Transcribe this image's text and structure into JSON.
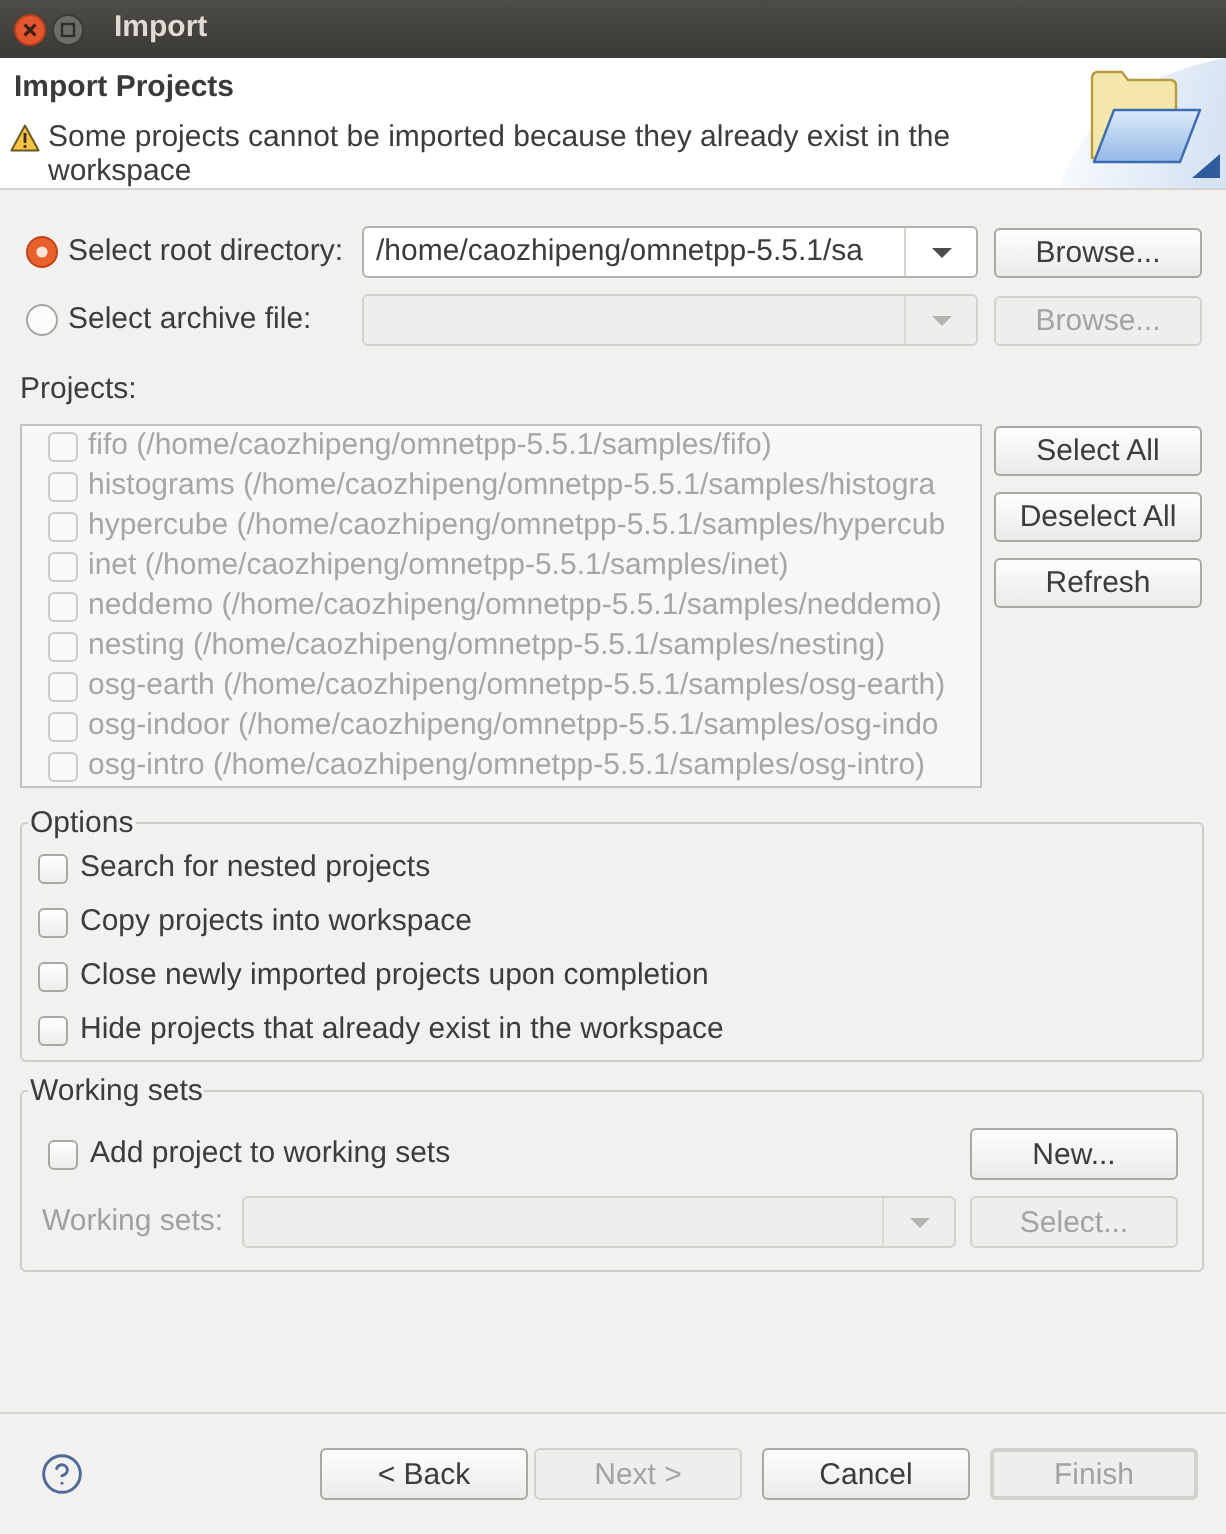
{
  "window": {
    "title": "Import"
  },
  "header": {
    "title": "Import Projects",
    "message": "Some projects cannot be imported because they already exist in the workspace"
  },
  "source": [
    {
      "label": "Select root directory:",
      "selected": true,
      "value": "/home/caozhipeng/omnetpp-5.5.1/sa",
      "disabled": false,
      "browse": {
        "label": "Browse...",
        "disabled": false
      }
    },
    {
      "label": "Select archive file:",
      "selected": false,
      "disabled": true,
      "browse": {
        "label": "Browse...",
        "disabled": true
      }
    }
  ],
  "projects": {
    "label": "Projects:",
    "items": [
      {
        "label": "fifo (/home/caozhipeng/omnetpp-5.5.1/samples/fifo)",
        "checked": false,
        "disabled": true
      },
      {
        "label": "histograms (/home/caozhipeng/omnetpp-5.5.1/samples/histogra",
        "checked": false,
        "disabled": true
      },
      {
        "label": "hypercube (/home/caozhipeng/omnetpp-5.5.1/samples/hypercub",
        "checked": false,
        "disabled": true
      },
      {
        "label": "inet (/home/caozhipeng/omnetpp-5.5.1/samples/inet)",
        "checked": false,
        "disabled": true
      },
      {
        "label": "neddemo (/home/caozhipeng/omnetpp-5.5.1/samples/neddemo)",
        "checked": false,
        "disabled": true
      },
      {
        "label": "nesting (/home/caozhipeng/omnetpp-5.5.1/samples/nesting)",
        "checked": false,
        "disabled": true
      },
      {
        "label": "osg-earth (/home/caozhipeng/omnetpp-5.5.1/samples/osg-earth)",
        "checked": false,
        "disabled": true
      },
      {
        "label": "osg-indoor (/home/caozhipeng/omnetpp-5.5.1/samples/osg-indo",
        "checked": false,
        "disabled": true
      },
      {
        "label": "osg-intro (/home/caozhipeng/omnetpp-5.5.1/samples/osg-intro)",
        "checked": false,
        "disabled": true
      }
    ],
    "buttons": [
      {
        "label": "Select All",
        "disabled": false
      },
      {
        "label": "Deselect All",
        "disabled": false
      },
      {
        "label": "Refresh",
        "disabled": false
      }
    ]
  },
  "options": {
    "title": "Options",
    "items": [
      {
        "label": "Search for nested projects",
        "checked": false
      },
      {
        "label": "Copy projects into workspace",
        "checked": false
      },
      {
        "label": "Close newly imported projects upon completion",
        "checked": false
      },
      {
        "label": "Hide projects that already exist in the workspace",
        "checked": false
      }
    ]
  },
  "working_sets": {
    "title": "Working sets",
    "add": {
      "label": "Add project to working sets",
      "checked": false
    },
    "new_button": {
      "label": "New...",
      "disabled": false
    },
    "field": {
      "label": "Working sets:",
      "disabled": true
    },
    "select_button": {
      "label": "Select...",
      "disabled": true
    }
  },
  "footer": {
    "buttons": [
      {
        "label": "< Back",
        "disabled": false,
        "default": false
      },
      {
        "label": "Next >",
        "disabled": true,
        "default": false
      },
      {
        "label": "Cancel",
        "disabled": false,
        "default": false
      },
      {
        "label": "Finish",
        "disabled": true,
        "default": true
      }
    ]
  }
}
